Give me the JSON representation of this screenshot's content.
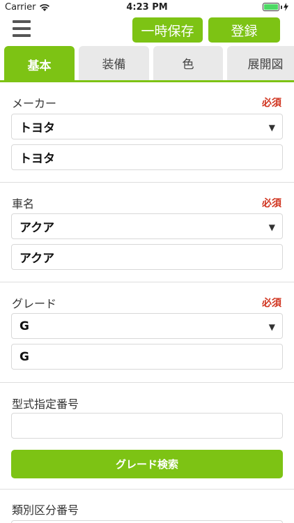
{
  "status_bar": {
    "carrier": "Carrier",
    "time": "4:23 PM"
  },
  "header": {
    "temp_save_label": "一時保存",
    "register_label": "登録"
  },
  "tabs": [
    {
      "label": "基本",
      "active": true
    },
    {
      "label": "装備",
      "active": false
    },
    {
      "label": "色",
      "active": false
    },
    {
      "label": "展開図",
      "active": false
    }
  ],
  "form": {
    "maker": {
      "label": "メーカー",
      "required": "必須",
      "selected": "トヨタ",
      "value": "トヨタ"
    },
    "car_name": {
      "label": "車名",
      "required": "必須",
      "selected": "アクア",
      "value": "アクア"
    },
    "grade": {
      "label": "グレード",
      "required": "必須",
      "selected": "G",
      "value": "G"
    },
    "model_number": {
      "label": "型式指定番号",
      "value": ""
    },
    "grade_search_label": "グレード検索",
    "category_number": {
      "label": "類別区分番号"
    }
  },
  "colors": {
    "accent": "#7dc314",
    "required": "#d0341f",
    "tab_inactive": "#e9e9e9"
  }
}
